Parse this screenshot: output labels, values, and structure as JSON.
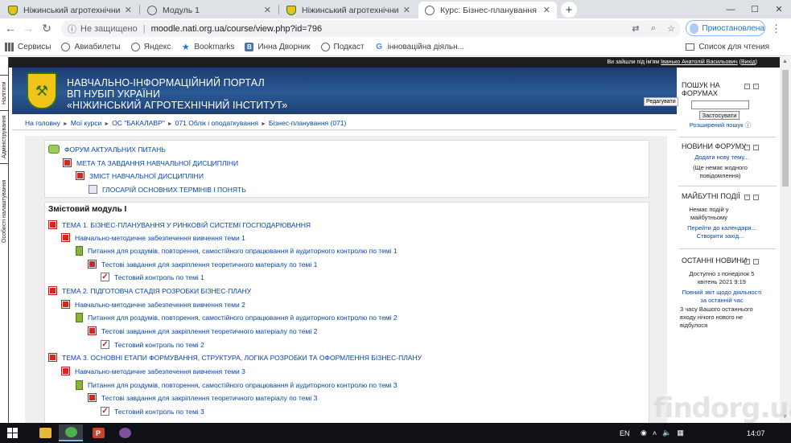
{
  "browser": {
    "tabs": [
      {
        "title": "Ніжинський агротехнічний інсти",
        "active": false,
        "icon": "shield-icon"
      },
      {
        "title": "Модуль 1",
        "active": false,
        "icon": "globe-icon"
      },
      {
        "title": "Ніжинський агротехнічний інсти",
        "active": false,
        "icon": "shield-icon"
      },
      {
        "title": "Курс: Бізнес-планування",
        "active": true,
        "icon": "globe-icon"
      }
    ],
    "new_tab": "+",
    "window_controls": {
      "minimize": "—",
      "maximize": "☐",
      "close": "✕"
    },
    "security_label": "Не защищено",
    "url": "moodle.nati.org.ua/course/view.php?id=796",
    "profile_label": "Приостановлена",
    "menu": "⋮",
    "bookmarks": [
      {
        "label": "Сервисы",
        "icon": "apps-grid-icon"
      },
      {
        "label": "Авиабилеты",
        "icon": "globe-icon"
      },
      {
        "label": "Яндекс",
        "icon": "globe-icon"
      },
      {
        "label": "Bookmarks",
        "icon": "star-icon"
      },
      {
        "label": "Инна Дворник",
        "icon": "vk-icon"
      },
      {
        "label": "Подкаст",
        "icon": "globe-icon"
      },
      {
        "label": "інноваційна діяльн...",
        "icon": "google-icon"
      }
    ],
    "reading_list": "Список для чтения"
  },
  "moodle": {
    "side_tabs": [
      "Налітати",
      "Адміністрування",
      "Особисті налаштування"
    ],
    "login_info_prefix": "Ви зайшли під ім'ям",
    "login_user": "Іванько Анатолій Васильович",
    "logout": "Вихід",
    "header": {
      "line1": "НАВЧАЛЬНО-ІНФОРМАЦІЙНИЙ ПОРТАЛ",
      "line2": "ВП НУБІП УКРАЇНИ",
      "line3": "«НІЖИНСЬКИЙ АГРОТЕХНІЧНИЙ ІНСТИТУТ»"
    },
    "edit_button": "Редагувати",
    "breadcrumb": [
      "На головну",
      "Мої курси",
      "ОС \"БАКАЛАВР\"",
      "071 Облік і оподаткування",
      "Бізнес-планування (071)"
    ],
    "top_section": [
      {
        "label": "ФОРУМ АКТУАЛЬНИХ ПИТАНЬ",
        "icon": "forum-icon"
      },
      {
        "label": "МЕТА ТА ЗАВДАННЯ НАВЧАЛЬНОЇ ДИСЦИПЛІНИ",
        "icon": "pdf-icon"
      },
      {
        "label": "ЗМІСТ НАВЧАЛЬНОЇ ДИСЦИПЛІНИ",
        "icon": "pdf-icon"
      },
      {
        "label": "ГЛОСАРІЙ ОСНОВНИХ ТЕРМІНІВ І ПОНЯТЬ",
        "icon": "glossary-icon"
      }
    ],
    "module_title": "Змістовий модуль І",
    "module_items": [
      {
        "label": "ТЕМА 1. БІЗНЕС-ПЛАНУВАННЯ У РИНКОВІЙ СИСТЕМІ ГОСПОДАРЮВАННЯ",
        "icon": "pdf-icon"
      },
      {
        "label": "Навчально-методичне забезпечення вивчення теми 1",
        "icon": "pdf-icon"
      },
      {
        "label": "Питання для роздумів, повторення, самостійного опрацювання й аудиторного контролю по темі 1",
        "icon": "book-icon"
      },
      {
        "label": "Тестові завдання для закріплення теоретичного матеріалу по темі 1",
        "icon": "pdf-icon"
      },
      {
        "label": "Тестовий контроль по темі 1",
        "icon": "quiz-icon"
      },
      {
        "label": "ТЕМА 2. ПІДГОТОВЧА СТАДІЯ РОЗРОБКИ БІЗНЕС-ПЛАНУ",
        "icon": "pdf-icon"
      },
      {
        "label": "Навчально-методичне забезпечення вивчення теми 2",
        "icon": "pdf-icon"
      },
      {
        "label": "Питання для роздумів, повторення, самостійного опрацювання й аудиторного контролю по темі 2",
        "icon": "book-icon"
      },
      {
        "label": "Тестові завдання для закріплення теоретичного матеріалу по темі 2",
        "icon": "pdf-icon"
      },
      {
        "label": "Тестовий контроль по темі 2",
        "icon": "quiz-icon"
      },
      {
        "label": "ТЕМА 3. ОСНОВНІ ЕТАПИ ФОРМУВАННЯ, СТРУКТУРА, ЛОГІКА РОЗРОБКИ ТА ОФОРМЛЕННЯ БІЗНЕС-ПЛАНУ",
        "icon": "pdf-icon"
      },
      {
        "label": "Навчально-методичне забезпечення вивчення теми 3",
        "icon": "pdf-icon"
      },
      {
        "label": "Питання для роздумів, повторення, самостійного опрацювання й аудиторного контролю по темі 3",
        "icon": "book-icon"
      },
      {
        "label": "Тестові завдання для закріплення теоретичного матеріалу по темі 3",
        "icon": "pdf-icon"
      },
      {
        "label": "Тестовий контроль по темі 3",
        "icon": "quiz-icon"
      }
    ],
    "blocks": {
      "search": {
        "title_1": "ПОШУК НА",
        "title_2": "ФОРУМАХ",
        "button": "Застосувати",
        "advanced": "Розширений пошук"
      },
      "news": {
        "title": "НОВИНИ ФОРУМУ",
        "add": "Додати нову тему...",
        "empty_1": "(Ще немає жодного",
        "empty_2": "повідомлення)"
      },
      "events": {
        "title": "МАЙБУТНІ ПОДІЇ",
        "none_1": "Немає подій у",
        "none_2": "майбутньому",
        "calendar": "Перейти до календаря...",
        "new_event": "Створити захід..."
      },
      "recent": {
        "title": "ОСТАННІ НОВИНИ",
        "since_1": "Доступно з понеділок 5",
        "since_2": "квітень 2021 9:19",
        "full_1": "Повний звіт щодо діяльності",
        "full_2": "за останній час",
        "msg_1": "3 часу Вашого останнього",
        "msg_2": "входу нічого нового не",
        "msg_3": "відбулося"
      }
    }
  },
  "taskbar": {
    "apps": [
      {
        "name": "explorer",
        "letter": "▭",
        "color": "#e8b83a"
      },
      {
        "name": "chrome",
        "letter": "●",
        "color": "#4caf50"
      },
      {
        "name": "powerpoint",
        "letter": "P",
        "color": "#c8442c"
      },
      {
        "name": "viber",
        "letter": "✆",
        "color": "#7b519d"
      }
    ],
    "lang": "EN",
    "time": "14:07"
  },
  "watermark": "findorg.ua"
}
